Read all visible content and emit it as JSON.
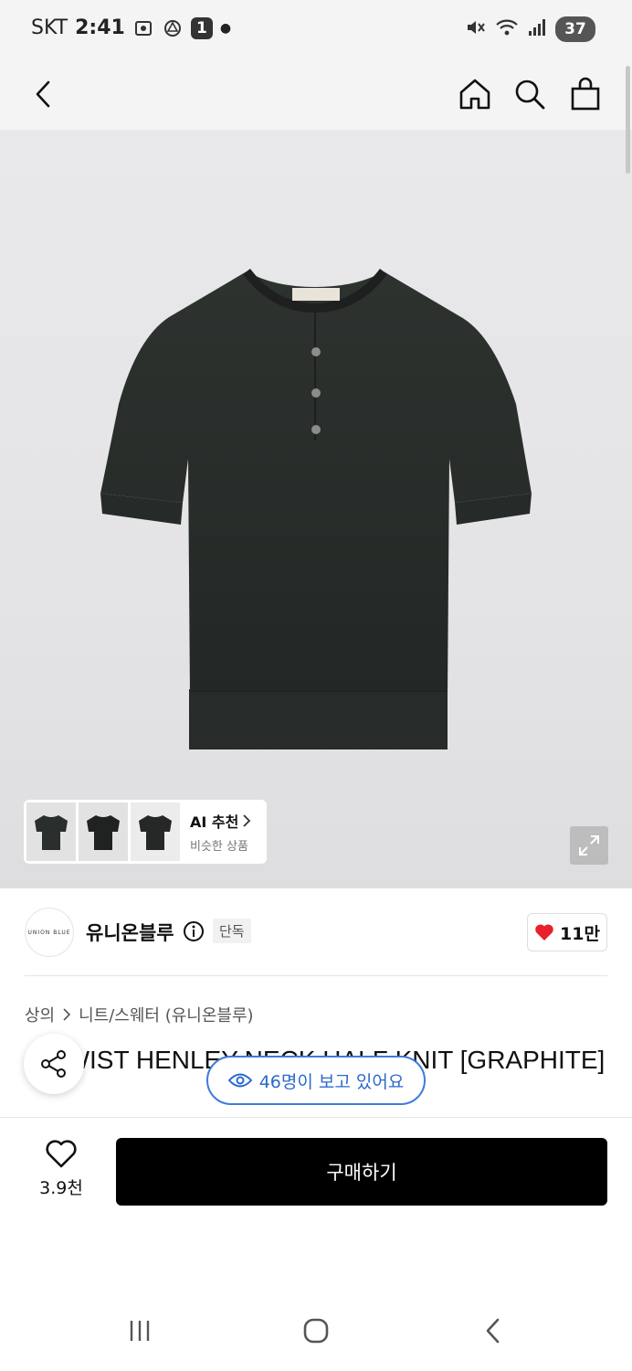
{
  "status": {
    "carrier": "SKT",
    "time": "2:41",
    "badge": "1",
    "battery": "37"
  },
  "nav": {
    "back_icon": "chevron-left-icon",
    "home_icon": "home-icon",
    "search_icon": "search-icon",
    "bag_icon": "shopping-bag-icon"
  },
  "gallery": {
    "ai_title": "AI 추천",
    "ai_subtitle": "비슷한 상품",
    "thumbnail_count": 3
  },
  "brand": {
    "logo_text": "UNION BLUE",
    "name": "유니온블루",
    "tag": "단독",
    "likes": "11만"
  },
  "product": {
    "breadcrumb": [
      "상의",
      "니트/스웨터 (유니온블루)"
    ],
    "title": "D TWIST HENLEY-NECK HALF KNIT [GRAPHITE]",
    "viewers": "46명이 보고 있어요"
  },
  "bottom": {
    "wish_count": "3.9천",
    "buy_label": "구매하기"
  },
  "colors": {
    "accent_blue": "#2a6acb",
    "heart_red": "#e8202a",
    "knit": "#2a2e2c"
  }
}
